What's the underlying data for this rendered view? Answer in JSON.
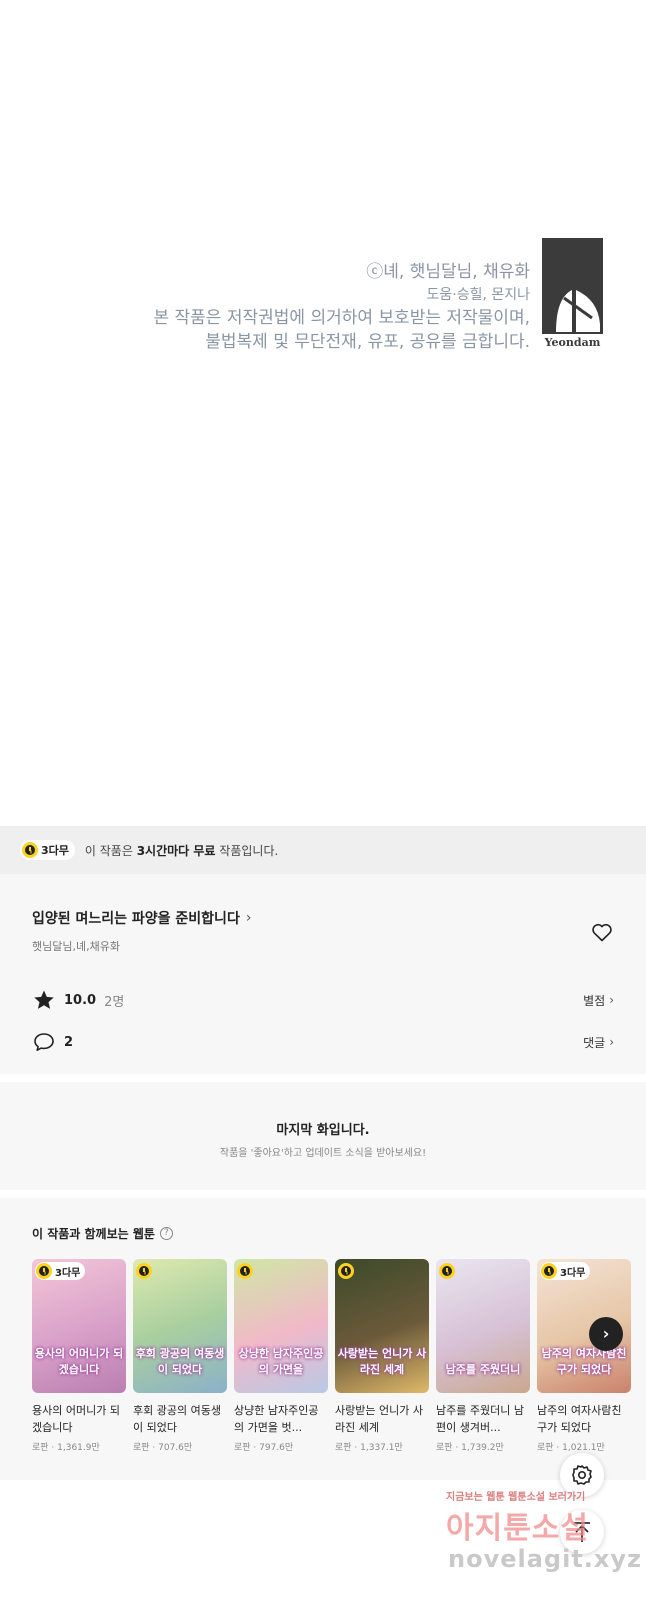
{
  "copyright": {
    "line1": "ⓒ녜, 햇님달님, 채유화",
    "line2": "도움·승힐, 몬지나",
    "line3": "본 작품은 저작권법에 의거하여 보호받는 저작물이며,",
    "line4": "불법복제 및 무단전재, 유포, 공유를 금합니다.",
    "logo_word": "Yeondam"
  },
  "free_banner": {
    "badge": "3다무",
    "text_prefix": "이 작품은 ",
    "text_bold": "3시간마다 무료",
    "text_suffix": " 작품입니다."
  },
  "work": {
    "title": "입양된 며느리는 파양을 준비합니다",
    "authors": "햇님달님,녜,채유화",
    "rating": "10.0",
    "rating_count": "2명",
    "rating_link": "별점",
    "comments": "2",
    "comments_link": "댓글"
  },
  "last_episode": {
    "title": "마지막 화입니다.",
    "subtitle": "작품을 '좋아요'하고 업데이트 소식을 받아보세요!"
  },
  "recommendations": {
    "heading": "이 작품과 함께보는 웹툰",
    "help": "?",
    "items": [
      {
        "title": "용사의 어머니가 되겠습니다",
        "meta": "로판 · 1,361.9만",
        "badge": "3다무",
        "art": "용사의 어머니가 되겠습니다",
        "bg": "linear-gradient(160deg,#f3c6d8,#d8a0c8 55%,#b97fb1)"
      },
      {
        "title": "후회 광공의 여동생이 되었다",
        "meta": "로판 · 707.6만",
        "badge": "",
        "art": "후회 광공의 여동생이 되었다",
        "bg": "linear-gradient(160deg,#dfe9b0,#a9cf9f 50%,#8bb1c9)"
      },
      {
        "title": "상냥한 남자주인공의 가면을 벗...",
        "meta": "로판 · 797.6만",
        "badge": "",
        "art": "상냥한 남자주인공의 가면을",
        "bg": "linear-gradient(160deg,#cfe7a6,#f1b9c8 55%,#b8c9e6)"
      },
      {
        "title": "사랑받는 언니가 사라진 세계",
        "meta": "로판 · 1,337.1만",
        "badge": "",
        "art": "사랑받는 언니가 사라진 세계",
        "bg": "linear-gradient(160deg,#3b4a2a,#6b5a3a 55%,#e0b96a)"
      },
      {
        "title": "남주를 주웠더니 남편이 생겨버...",
        "meta": "로판 · 1,739.2만",
        "badge": "",
        "art": "남주를 주웠더니",
        "bg": "linear-gradient(160deg,#e9e6ef,#d7c1d6 55%,#c9a88f)"
      },
      {
        "title": "남주의 여자사람친구가 되었다",
        "meta": "로판 · 1,021.1만",
        "badge": "3다무",
        "art": "남주의 여자사람친구가 되었다",
        "bg": "linear-gradient(160deg,#f4e3d6,#e6c6a6 55%,#c9826b)"
      }
    ]
  },
  "next_button": "›",
  "watermark": {
    "small": "지금보는 웹툰 웹툰소설 보러가기",
    "big": "아지툰소설",
    "url": "novelagit.xyz"
  },
  "colors": {
    "accent_yellow": "#ffd21f",
    "text_gray": "#8a96a4",
    "panel": "#f7f7f7",
    "banner": "#efefef"
  }
}
